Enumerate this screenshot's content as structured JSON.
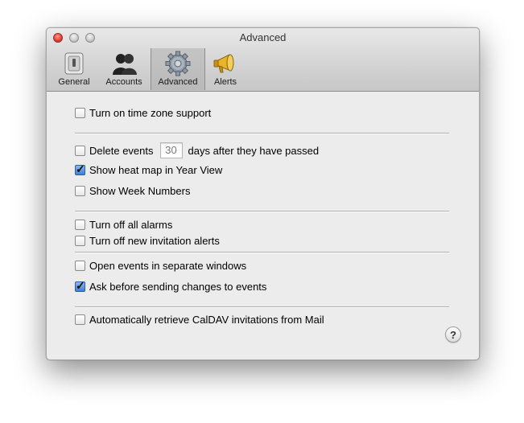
{
  "window": {
    "title": "Advanced"
  },
  "toolbar": {
    "tabs": [
      {
        "label": "General",
        "icon": "switch-icon",
        "selected": false
      },
      {
        "label": "Accounts",
        "icon": "accounts-icon",
        "selected": false
      },
      {
        "label": "Advanced",
        "icon": "gear-icon",
        "selected": true
      },
      {
        "label": "Alerts",
        "icon": "megaphone-icon",
        "selected": false
      }
    ]
  },
  "options": {
    "time_zone": {
      "label": "Turn on time zone support",
      "checked": false
    },
    "delete_events": {
      "label_before": "Delete events",
      "days": "30",
      "label_after": "days after they have passed",
      "checked": false
    },
    "heat_map": {
      "label": "Show heat map in Year View",
      "checked": true
    },
    "week_numbers": {
      "label": "Show Week Numbers",
      "checked": false
    },
    "all_alarms": {
      "label": "Turn off all alarms",
      "checked": false
    },
    "invitation_alerts": {
      "label": "Turn off new invitation alerts",
      "checked": false
    },
    "separate_windows": {
      "label": "Open events in separate windows",
      "checked": false
    },
    "ask_before": {
      "label": "Ask before sending changes to events",
      "checked": true
    },
    "caldav": {
      "label": "Automatically retrieve CalDAV invitations from Mail",
      "checked": false
    }
  },
  "help": {
    "label": "?"
  }
}
